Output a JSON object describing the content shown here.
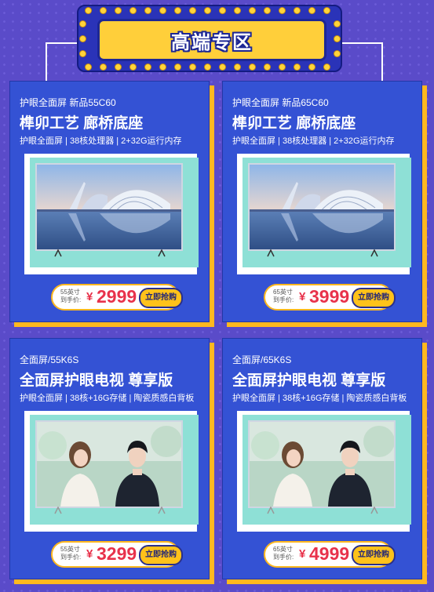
{
  "banner": {
    "title": "高端专区"
  },
  "products": [
    {
      "series": "护眼全面屏 新品55C60",
      "title": "榫卯工艺 廊桥底座",
      "specs": "护眼全面屏 | 38核处理器 | 2+32G运行内存",
      "screen_image": "opera-house-landscape",
      "price": {
        "size": "55英寸",
        "label": "到手价:",
        "currency": "¥",
        "value": "2999"
      },
      "buy_label": "立即抢购"
    },
    {
      "series": "护眼全面屏 新品65C60",
      "title": "榫卯工艺 廊桥底座",
      "specs": "护眼全面屏 | 38核处理器 | 2+32G运行内存",
      "screen_image": "opera-house-landscape",
      "price": {
        "size": "65英寸",
        "label": "到手价:",
        "currency": "¥",
        "value": "3999"
      },
      "buy_label": "立即抢购"
    },
    {
      "series": "全面屏/55K6S",
      "title": "全面屏护眼电视 尊享版",
      "specs": "护眼全面屏 | 38核+16G存储 | 陶瓷质感白背板",
      "screen_image": "couple-portrait",
      "price": {
        "size": "55英寸",
        "label": "到手价:",
        "currency": "¥",
        "value": "3299"
      },
      "buy_label": "立即抢购"
    },
    {
      "series": "全面屏/65K6S",
      "title": "全面屏护眼电视 尊享版",
      "specs": "护眼全面屏 | 38核+16G存储 | 陶瓷质感白背板",
      "screen_image": "couple-portrait",
      "price": {
        "size": "65英寸",
        "label": "到手价:",
        "currency": "¥",
        "value": "4999"
      },
      "buy_label": "立即抢购"
    }
  ]
}
